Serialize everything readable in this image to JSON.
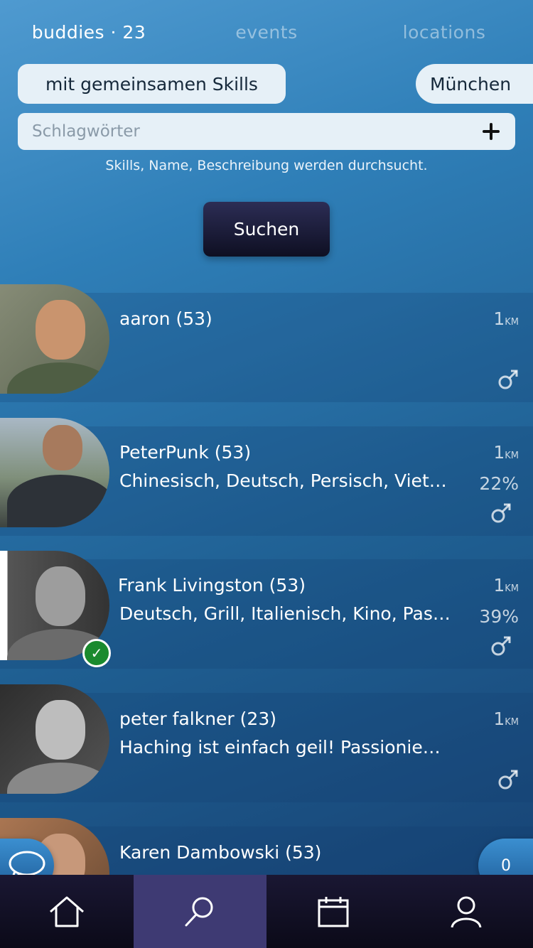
{
  "tabs": [
    {
      "label": "buddies · 23"
    },
    {
      "label": "events"
    },
    {
      "label": "locations"
    }
  ],
  "filters": {
    "skills": "mit gemeinsamen Skills",
    "city": "München"
  },
  "search": {
    "placeholder": "Schlagwörter",
    "hint": "Skills, Name, Beschreibung werden durchsucht.",
    "button": "Suchen"
  },
  "buddies": [
    {
      "name": "aaron (53)",
      "subtitle": "",
      "distance": "1",
      "unit": "KM",
      "match": "",
      "verified": false
    },
    {
      "name": "PeterPunk (53)",
      "subtitle": "Chinesisch, Deutsch, Persisch, Viet…",
      "distance": "1",
      "unit": "KM",
      "match": "22%",
      "verified": false
    },
    {
      "name": "Frank Livingston (53)",
      "subtitle": "Deutsch, Grill, Italienisch, Kino, Pas…",
      "distance": "1",
      "unit": "KM",
      "match": "39%",
      "verified": true
    },
    {
      "name": "peter falkner (23)",
      "subtitle": "Haching ist einfach geil! Passionie…",
      "distance": "1",
      "unit": "KM",
      "match": "",
      "verified": false
    },
    {
      "name": "Karen Dambowski (53)",
      "subtitle": "",
      "distance": "",
      "unit": "",
      "match": "",
      "verified": false
    }
  ],
  "chat_count": "0",
  "colors": {
    "accent": "#3e3a73",
    "verified": "#1a8a2e",
    "background": "#2f7fb8"
  },
  "icons": [
    "chat-icon",
    "home-icon",
    "search-icon",
    "calendar-icon",
    "profile-icon",
    "male-icon",
    "plus-icon",
    "check-icon"
  ]
}
